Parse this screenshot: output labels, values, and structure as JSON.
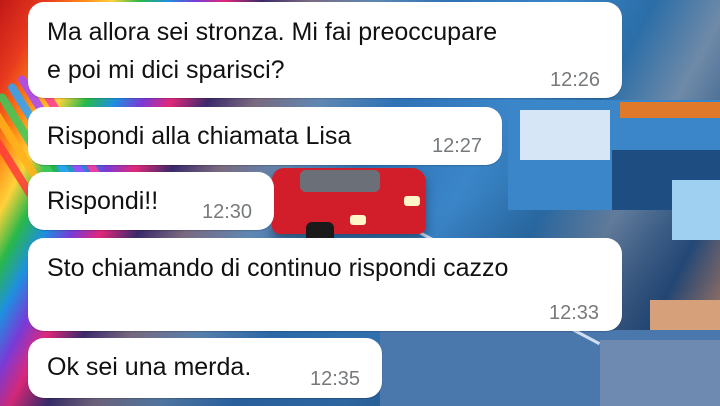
{
  "chat": {
    "messages": [
      {
        "text_lines": [
          "Ma allora sei stronza. Mi fai preoccupare",
          "e poi mi dici sparisci?"
        ],
        "time": "12:26"
      },
      {
        "text_lines": [
          "Rispondi alla chiamata Lisa"
        ],
        "time": "12:27"
      },
      {
        "text_lines": [
          "Rispondi!!"
        ],
        "time": "12:30"
      },
      {
        "text_lines": [
          "Sto chiamando di continuo rispondi cazzo"
        ],
        "time": "12:33"
      },
      {
        "text_lines": [
          "Ok sei una merda."
        ],
        "time": "12:35"
      }
    ]
  },
  "colors": {
    "bubble_background": "#ffffff",
    "message_text": "#111111",
    "timestamp_text": "#777a7d"
  },
  "wallpaper": {
    "icon": "city-street-wallpaper"
  }
}
